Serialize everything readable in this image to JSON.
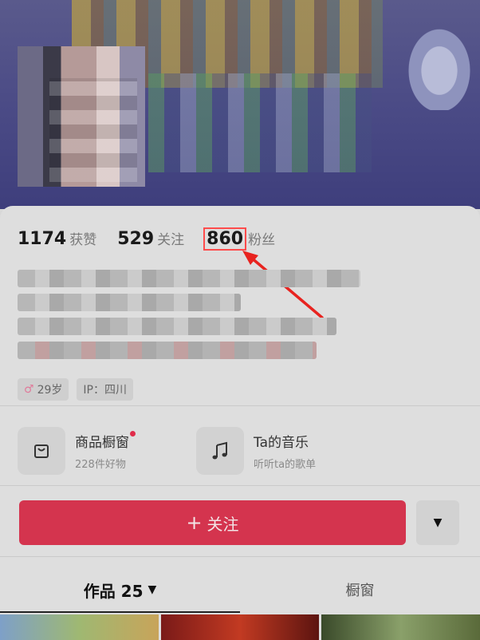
{
  "stats": [
    {
      "num": "1174",
      "label": "获赞"
    },
    {
      "num": "529",
      "label": "关注"
    },
    {
      "num": "860",
      "label": "粉丝"
    }
  ],
  "tags": [
    {
      "icon": "♂",
      "text": "29岁"
    },
    {
      "icon": "",
      "text": "IP：四川"
    }
  ],
  "entries": [
    {
      "title": "商品橱窗",
      "sub": "228件好物",
      "icon": "shop-bag-icon",
      "has_dot": true
    },
    {
      "title": "Ta的音乐",
      "sub": "听听ta的歌单",
      "icon": "music-note-icon",
      "has_dot": false
    }
  ],
  "follow_button": {
    "plus": "+",
    "label": "关注"
  },
  "more_button": {
    "symbol": "▼"
  },
  "tabs": [
    {
      "label": "作品 25",
      "caret": "▼"
    },
    {
      "label": "橱窗"
    }
  ],
  "colors": {
    "accent": "#d4344e",
    "highlight": "#ff4c4c"
  }
}
